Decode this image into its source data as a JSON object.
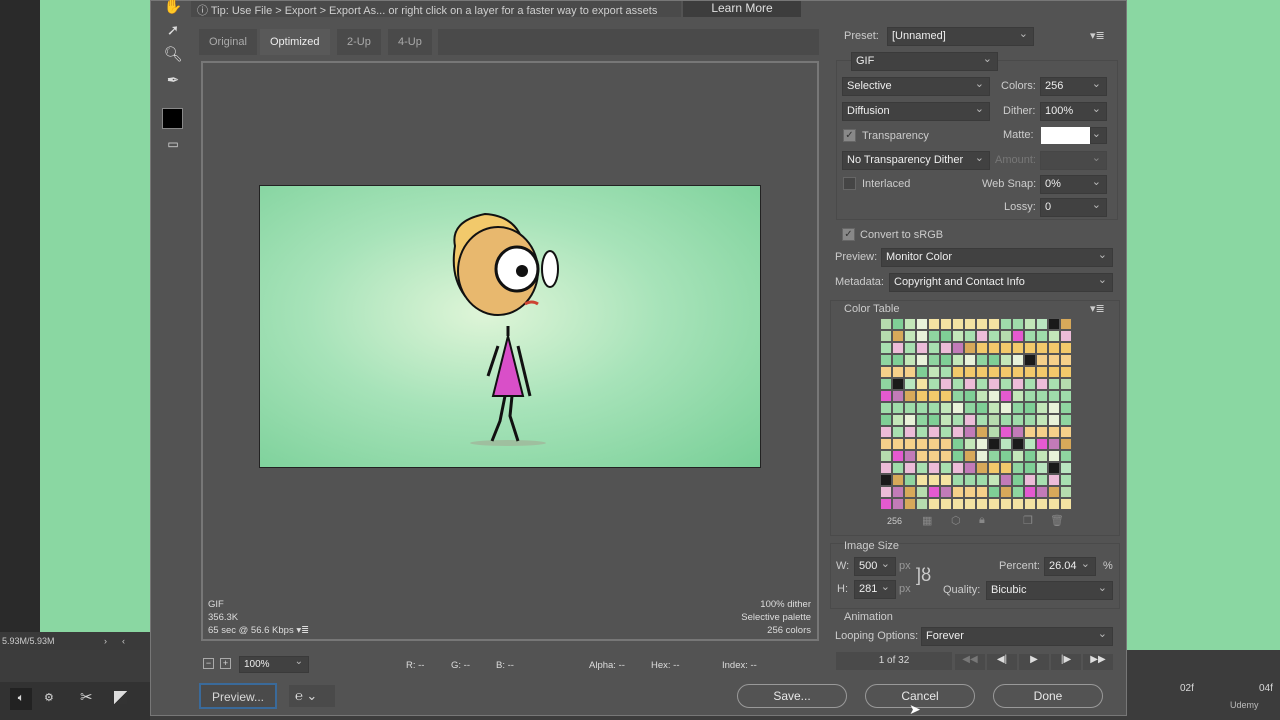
{
  "host": {
    "status": "5.93M/5.93M",
    "timeline": {
      "f2": "02f",
      "f4": "04f"
    },
    "brand": "Udemy"
  },
  "dialog": {
    "tip": "Tip: Use File > Export > Export As...  or right click on a layer for a faster way to export assets",
    "learn_more": "Learn More",
    "tabs": [
      {
        "label": "Original"
      },
      {
        "label": "Optimized"
      },
      {
        "label": "2-Up"
      },
      {
        "label": "4-Up"
      }
    ],
    "info_left": {
      "format": "GIF",
      "size": "356.3K",
      "time": "65 sec @ 56.6 Kbps"
    },
    "info_right": {
      "dither": "100% dither",
      "palette": "Selective palette",
      "colors": "256 colors"
    },
    "zoom": "100%",
    "readouts": {
      "r": "R: --",
      "g": "G: --",
      "b": "B: --",
      "alpha": "Alpha: --",
      "hex": "Hex: --",
      "index": "Index: --"
    },
    "buttons": {
      "preview": "Preview...",
      "save": "Save...",
      "cancel": "Cancel",
      "done": "Done"
    },
    "settings": {
      "preset_label": "Preset:",
      "preset": "[Unnamed]",
      "format": "GIF",
      "reduction": "Selective",
      "colors_label": "Colors:",
      "colors": "256",
      "dither_algo": "Diffusion",
      "dither_label": "Dither:",
      "dither": "100%",
      "transparency": "Transparency",
      "transparency_checked": true,
      "matte_label": "Matte:",
      "matte_color": "#ffffff",
      "trans_dither": "No Transparency Dither",
      "amount_label": "Amount:",
      "interlaced": "Interlaced",
      "interlaced_checked": false,
      "websnap_label": "Web Snap:",
      "websnap": "0%",
      "lossy_label": "Lossy:",
      "lossy": "0",
      "srgb": "Convert to sRGB",
      "srgb_checked": true,
      "preview_label": "Preview:",
      "preview": "Monitor Color",
      "metadata_label": "Metadata:",
      "metadata": "Copyright and Contact Info"
    },
    "color_table": {
      "title": "Color Table",
      "count": "256",
      "palette": [
        "#f2c96b",
        "#e45ad0",
        "#a8e0b0",
        "#c3e7b9",
        "#f5d08a",
        "#b6dcae",
        "#1a1a1a",
        "#e8f2d9",
        "#9fdcaa",
        "#d7a95a",
        "#ecbcd8",
        "#8fd5a0",
        "#f4e3a2",
        "#c27bb8",
        "#b9e6c0",
        "#7fcf96"
      ]
    },
    "image_size": {
      "title": "Image Size",
      "w_label": "W:",
      "w": "500",
      "h_label": "H:",
      "h": "281",
      "unit": "px",
      "percent_label": "Percent:",
      "percent": "26.04",
      "pct": "%",
      "quality_label": "Quality:",
      "quality": "Bicubic"
    },
    "animation": {
      "title": "Animation",
      "looping_label": "Looping Options:",
      "looping": "Forever",
      "frame": "1 of 32"
    }
  }
}
